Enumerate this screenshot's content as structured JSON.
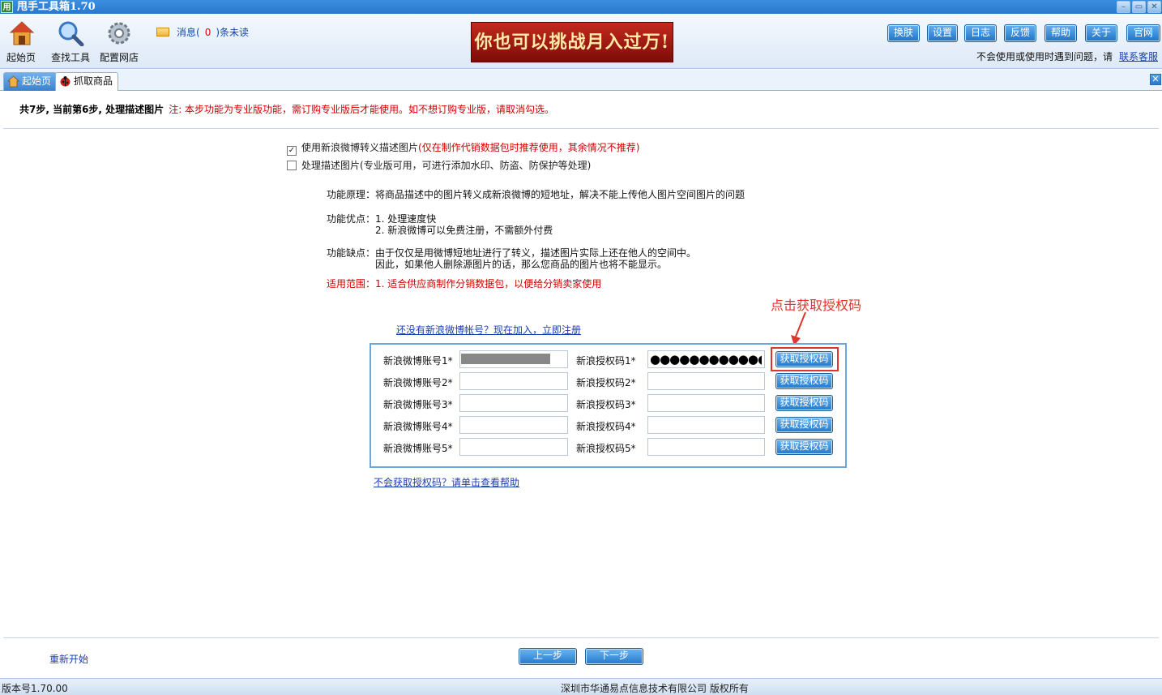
{
  "window": {
    "app_icon_text": "用",
    "title": "甩手工具箱1.70"
  },
  "toolbar": {
    "tools": [
      {
        "label": "起始页",
        "icon": "home-icon"
      },
      {
        "label": "查找工具",
        "icon": "magnifier-icon"
      },
      {
        "label": "配置网店",
        "icon": "gear-icon"
      }
    ],
    "messages": {
      "prefix": "消息(",
      "count": "0",
      "suffix": ")条未读"
    },
    "banner_text": "你也可以挑战月入过万!",
    "top_buttons": [
      "换肤",
      "设置",
      "日志",
      "反馈",
      "帮助",
      "关于",
      "官网"
    ],
    "help_text": "不会使用或使用时遇到问题，请",
    "help_link": "联系客服"
  },
  "tabs": [
    {
      "label": "起始页",
      "icon": "home-icon",
      "active": false
    },
    {
      "label": "抓取商品",
      "icon": "ladybug-icon",
      "active": true
    }
  ],
  "step": {
    "title": "共7步, 当前第6步, 处理描述图片",
    "note": "注: 本步功能为专业版功能，需订购专业版后才能使用。如不想订购专业版，请取消勾选。"
  },
  "options": [
    {
      "checked": true,
      "label": "使用新浪微博转义描述图片",
      "hint": "(仅在制作代销数据包时推荐使用，其余情况不推荐)"
    },
    {
      "checked": false,
      "label": "处理描述图片(专业版可用，可进行添加水印、防盗、防保护等处理)",
      "hint": ""
    }
  ],
  "description": {
    "principle": "功能原理：将商品描述中的图片转义成新浪微博的短地址，解决不能上传他人图片空间图片的问题",
    "advantages_1": "功能优点：1. 处理速度快",
    "advantages_2": "2. 新浪微博可以免费注册，不需额外付费",
    "disadvantages_1": "功能缺点：由于仅仅是用微博短地址进行了转义，描述图片实际上还在他人的空间中。",
    "disadvantages_2": "因此，如果他人删除源图片的话，那么您商品的图片也将不能显示。",
    "scope": "适用范围：1. 适合供应商制作分销数据包，以便给分销卖家使用"
  },
  "register_link": "还没有新浪微博帐号？现在加入，立即注册",
  "annotation": "点击获取授权码",
  "accounts": [
    {
      "account_label": "新浪微博账号1*",
      "code_label": "新浪授权码1*",
      "account_masked": true,
      "code_value": "●●●●●●●●●●●●●",
      "button": "获取授权码"
    },
    {
      "account_label": "新浪微博账号2*",
      "code_label": "新浪授权码2*",
      "account_masked": false,
      "code_value": "",
      "button": "获取授权码"
    },
    {
      "account_label": "新浪微博账号3*",
      "code_label": "新浪授权码3*",
      "account_masked": false,
      "code_value": "",
      "button": "获取授权码"
    },
    {
      "account_label": "新浪微博账号4*",
      "code_label": "新浪授权码4*",
      "account_masked": false,
      "code_value": "",
      "button": "获取授权码"
    },
    {
      "account_label": "新浪微博账号5*",
      "code_label": "新浪授权码5*",
      "account_masked": false,
      "code_value": "",
      "button": "获取授权码"
    }
  ],
  "help_link2": "不会获取授权码？请单击查看帮助",
  "footer": {
    "restart": "重新开始",
    "prev": "上一步",
    "next": "下一步"
  },
  "statusbar": {
    "version": "版本号1.70.00",
    "copyright": "深圳市华通易点信息技术有限公司 版权所有"
  },
  "colors": {
    "accent_blue": "#2a78cc",
    "note_red": "#d00000",
    "annotation_red": "#e0352b",
    "banner_red": "#a81c12"
  }
}
